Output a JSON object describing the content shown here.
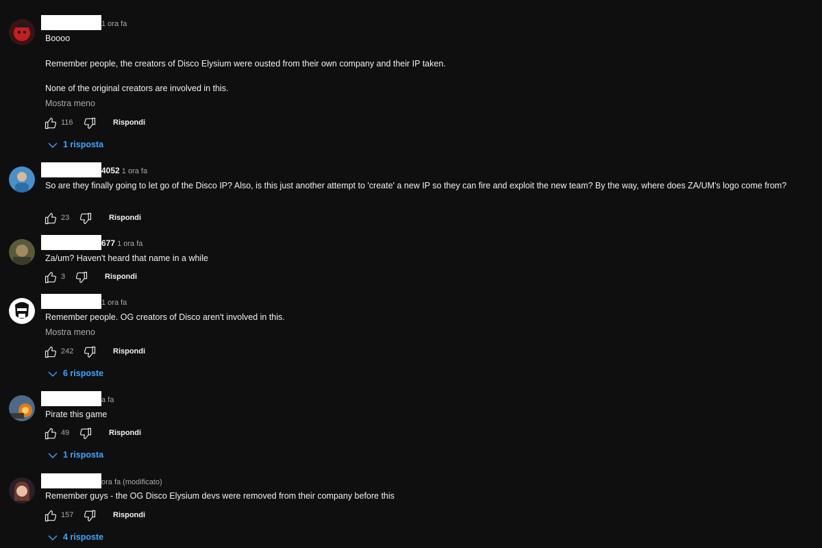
{
  "comments": [
    {
      "handle_tail": "",
      "time": "1 ora fa",
      "lines": [
        "Boooo",
        "Remember people, the creators of Disco Elysium were ousted from their own company and their IP taken.",
        "None of the original creators are involved in this."
      ],
      "show_less": "Mostra meno",
      "likes": "116",
      "reply_label": "Rispondi",
      "replies_label": "1 risposta"
    },
    {
      "handle_tail": "4052",
      "time": "1 ora fa",
      "lines": [
        "So are they finally going to let go of the Disco IP? Also, is this just another attempt to 'create' a new IP so they can fire and exploit the new team? By the way, where does ZA/UM's logo come from?"
      ],
      "likes": "23",
      "reply_label": "Rispondi"
    },
    {
      "handle_tail": "677",
      "time": "1 ora fa",
      "lines": [
        "Za/um? Haven't heard that name in a while"
      ],
      "likes": "3",
      "reply_label": "Rispondi"
    },
    {
      "handle_tail": "",
      "time": "1 ora fa",
      "lines": [
        "Remember people. OG creators of Disco aren't involved in this."
      ],
      "show_less": "Mostra meno",
      "likes": "242",
      "reply_label": "Rispondi",
      "replies_label": "6 risposte"
    },
    {
      "handle_tail": "",
      "time": "a fa",
      "lines": [
        "Pirate this game"
      ],
      "likes": "49",
      "reply_label": "Rispondi",
      "replies_label": "1 risposta"
    },
    {
      "handle_tail": "",
      "time": "ora fa (modificato)",
      "lines": [
        "Remember guys - the OG Disco Elysium devs were removed from their company before this"
      ],
      "likes": "157",
      "reply_label": "Rispondi",
      "replies_label": "4 risposte"
    }
  ],
  "icons": {
    "like": "thumb-up-icon",
    "dislike": "thumb-down-icon",
    "expand": "chevron-down-icon"
  },
  "colors": {
    "background": "#0f0f0f",
    "text": "#f1f1f1",
    "secondary": "#aaaaaa",
    "link": "#3ea6ff"
  }
}
